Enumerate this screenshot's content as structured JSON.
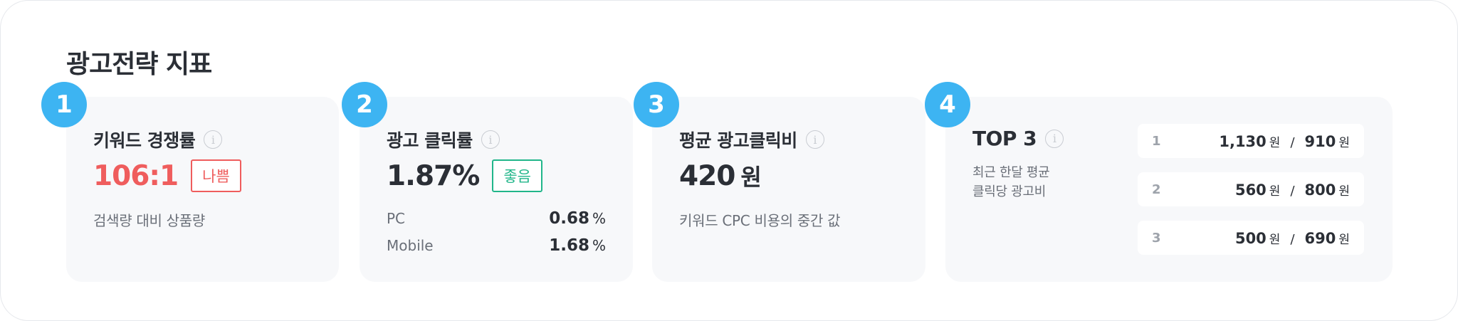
{
  "section_title": "광고전략 지표",
  "cards": {
    "competition": {
      "badge": "1",
      "title": "키워드 경쟁률",
      "value": "106:1",
      "status": "나쁨",
      "desc": "검색량 대비 상품량"
    },
    "ctr": {
      "badge": "2",
      "title": "광고 클릭률",
      "value": "1.87%",
      "status": "좋음",
      "rows": [
        {
          "label": "PC",
          "value": "0.68",
          "unit": "%"
        },
        {
          "label": "Mobile",
          "value": "1.68",
          "unit": "%"
        }
      ]
    },
    "cpc": {
      "badge": "3",
      "title": "평균 광고클릭비",
      "value": "420",
      "unit": "원",
      "desc": "키워드 CPC 비용의 중간 값"
    },
    "top3": {
      "badge": "4",
      "title": "TOP 3",
      "desc_line1": "최근 한달 평균",
      "desc_line2": "클릭당 광고비",
      "rows": [
        {
          "rank": "1",
          "a": "1,130",
          "b": "910",
          "unit": "원",
          "sep": "/"
        },
        {
          "rank": "2",
          "a": "560",
          "b": "800",
          "unit": "원",
          "sep": "/"
        },
        {
          "rank": "3",
          "a": "500",
          "b": "690",
          "unit": "원",
          "sep": "/"
        }
      ]
    }
  },
  "colors": {
    "badge": "#3db4f2",
    "bad": "#ef5d5d",
    "good": "#21b68a",
    "card_bg": "#f7f8fa"
  },
  "icons": {
    "info": "info-icon"
  }
}
